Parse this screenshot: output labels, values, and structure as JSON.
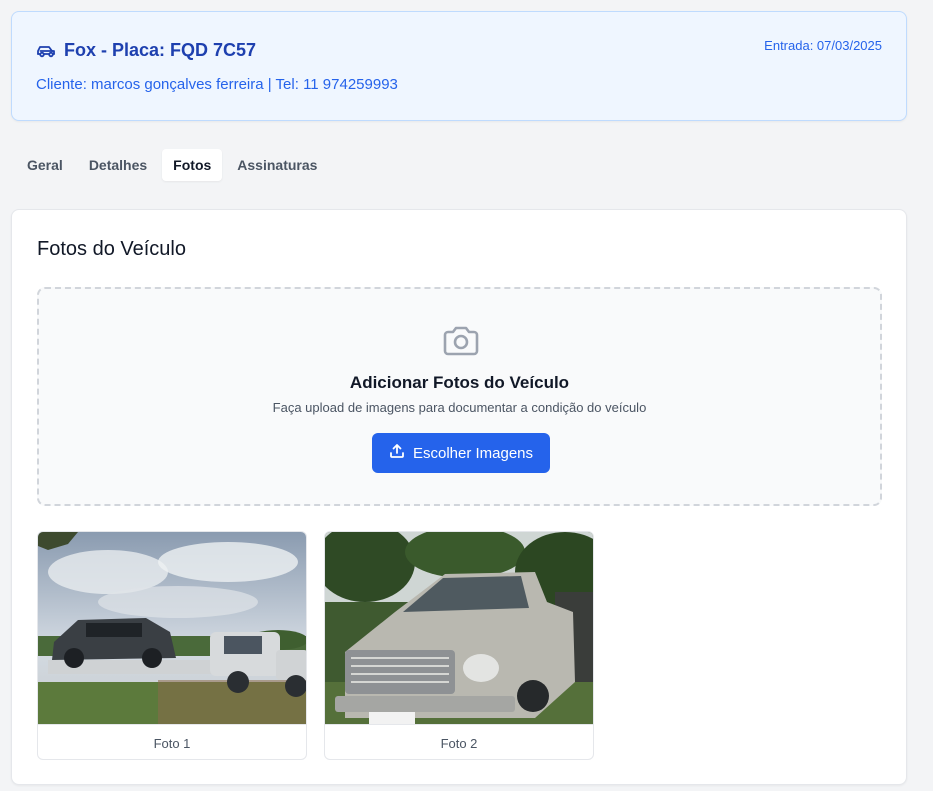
{
  "header": {
    "title": "Fox - Placa: FQD 7C57",
    "client_line": "Cliente: marcos gonçalves ferreira | Tel: 11 974259993",
    "entry_date": "Entrada: 07/03/2025",
    "icon": "car-icon"
  },
  "tabs": [
    {
      "label": "Geral",
      "active": false
    },
    {
      "label": "Detalhes",
      "active": false
    },
    {
      "label": "Fotos",
      "active": true
    },
    {
      "label": "Assinaturas",
      "active": false
    }
  ],
  "photos_section": {
    "title": "Fotos do Veículo",
    "dropzone": {
      "icon": "camera-icon",
      "title": "Adicionar Fotos do Veículo",
      "description": "Faça upload de imagens para documentar a condição do veículo",
      "button_label": "Escolher Imagens",
      "button_icon": "upload-icon"
    },
    "photos": [
      {
        "caption": "Foto 1"
      },
      {
        "caption": "Foto 2"
      }
    ]
  },
  "colors": {
    "accent": "#2563eb",
    "header_bg": "#eff6ff",
    "header_title": "#1e40af"
  }
}
